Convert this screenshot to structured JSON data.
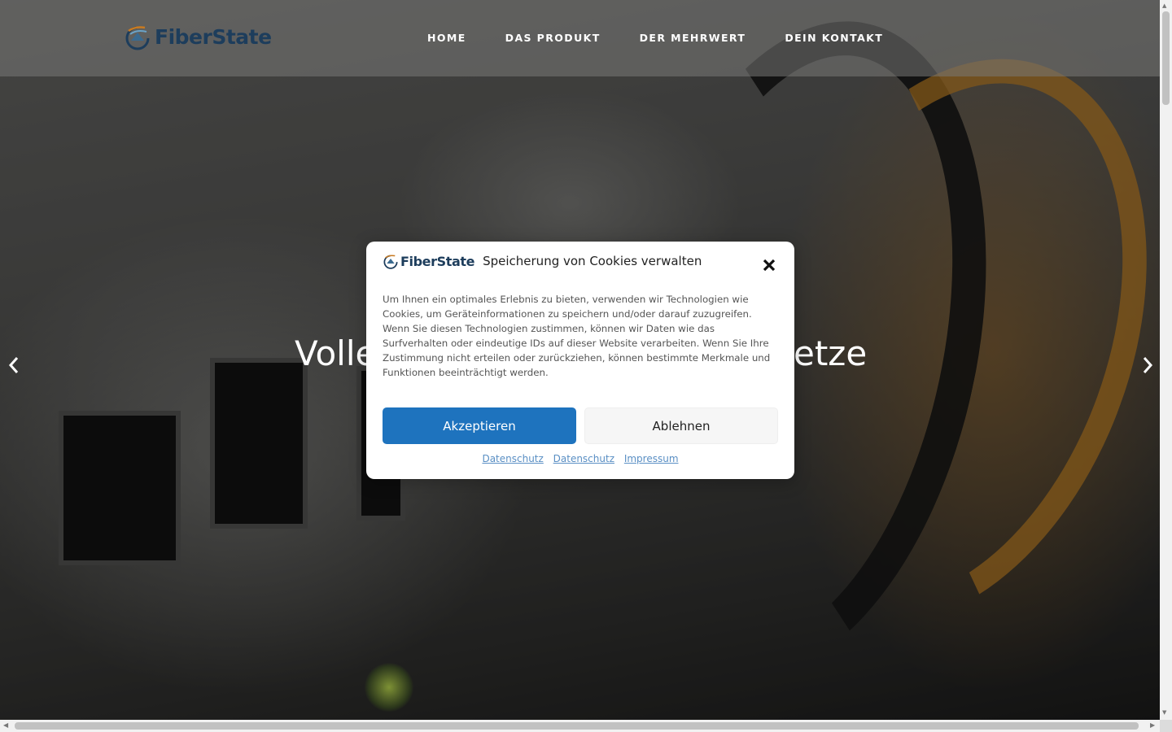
{
  "brand": {
    "name": "FiberState"
  },
  "nav": {
    "items": [
      {
        "label": "HOME"
      },
      {
        "label": "DAS PRODUKT"
      },
      {
        "label": "DER MEHRWERT"
      },
      {
        "label": "DEIN KONTAKT"
      }
    ]
  },
  "hero": {
    "headline_left": "Volle",
    "headline_right": "etze"
  },
  "cookie_modal": {
    "brand": "FiberState",
    "title": "Speicherung von Cookies verwalten",
    "body": "Um Ihnen ein optimales Erlebnis zu bieten, verwenden wir Technologien wie Cookies, um Geräteinformationen zu speichern und/oder darauf zuzugreifen. Wenn Sie diesen Technologien zustimmen, können wir Daten wie das Surfverhalten oder eindeutige IDs auf dieser Website verarbeiten. Wenn Sie Ihre Zustimmung nicht erteilen oder zurückziehen, können bestimmte Merkmale und Funktionen beeinträchtigt werden.",
    "accept_label": "Akzeptieren",
    "decline_label": "Ablehnen",
    "links": [
      {
        "label": "Datenschutz"
      },
      {
        "label": "Datenschutz"
      },
      {
        "label": "Impressum"
      }
    ]
  },
  "colors": {
    "accent": "#1e73be",
    "brand_text": "#1d3d5c",
    "link": "#5a8fc4"
  },
  "icons": {
    "close": "close-icon",
    "prev": "chevron-left-icon",
    "next": "chevron-right-icon",
    "logo": "fiberstate-logo-icon"
  }
}
